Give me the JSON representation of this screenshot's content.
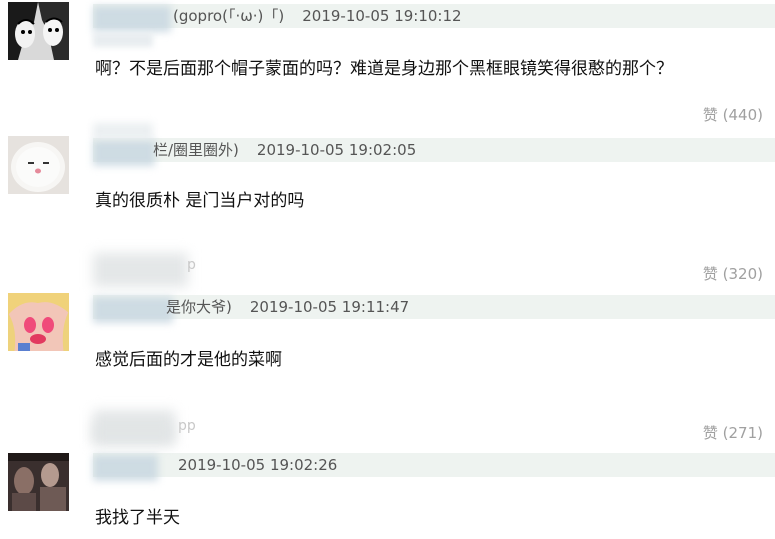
{
  "comments": [
    {
      "meta": "(gopro(「·ω·)「)",
      "timestamp": "2019-10-05 19:10:12",
      "text": "啊？不是后面那个帽子蒙面的吗？难道是身边那个黑框眼镜笑得很憨的那个？",
      "likes": "赞 (440)",
      "source": ""
    },
    {
      "meta": "栏/圈里圈外)",
      "timestamp": "2019-10-05 19:02:05",
      "text": "真的很质朴 是门当户对的吗",
      "likes": "赞 (320)",
      "source": "p"
    },
    {
      "meta": "是你大爷)",
      "timestamp": "2019-10-05 19:11:47",
      "text": "感觉后面的才是他的菜啊",
      "likes": "赞 (271)",
      "source": "pp"
    },
    {
      "meta": "",
      "timestamp": "2019-10-05 19:02:26",
      "text": "我找了半天",
      "likes": "",
      "source": ""
    }
  ],
  "colors": {
    "meta_bar": "#eef3f0",
    "like_text": "#a0a0a0",
    "timestamp_text": "#555555"
  }
}
